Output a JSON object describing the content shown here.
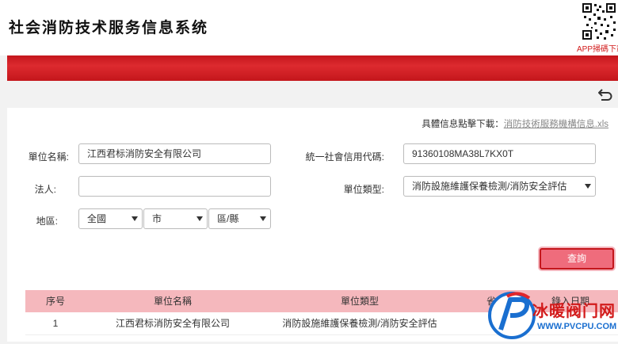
{
  "header": {
    "title": "社会消防技术服务信息系统",
    "app_label": "APP掃碼下載"
  },
  "download": {
    "prompt": "具體信息點擊下載：",
    "link_text": "消防技術服務機構信息.xls"
  },
  "form": {
    "unit_name_label": "單位名稱:",
    "unit_name_value": "江西君标消防安全有限公司",
    "credit_code_label": "統一社會信用代碼:",
    "credit_code_value": "91360108MA38L7KX0T",
    "legal_person_label": "法人:",
    "legal_person_value": "",
    "unit_type_label": "單位類型:",
    "unit_type_value": "消防設施維護保養檢測/消防安全評估",
    "region_label": "地區:",
    "region_province": "全國",
    "region_city": "市",
    "region_district": "區/縣"
  },
  "query_button": "查詢",
  "table": {
    "headers": [
      "序号",
      "單位名稱",
      "單位類型",
      "省",
      "錄入日期"
    ],
    "rows": [
      [
        "1",
        "江西君标消防安全有限公司",
        "消防設施維護保養檢測/消防安全評估",
        "",
        ""
      ]
    ]
  },
  "watermark": {
    "title": "冰暖阀门网",
    "url": "WWW.PVCPU.COM"
  },
  "colors": {
    "brand_red": "#c4161c",
    "table_header": "#f5b8bd",
    "query_button": "#ef6c7c"
  }
}
